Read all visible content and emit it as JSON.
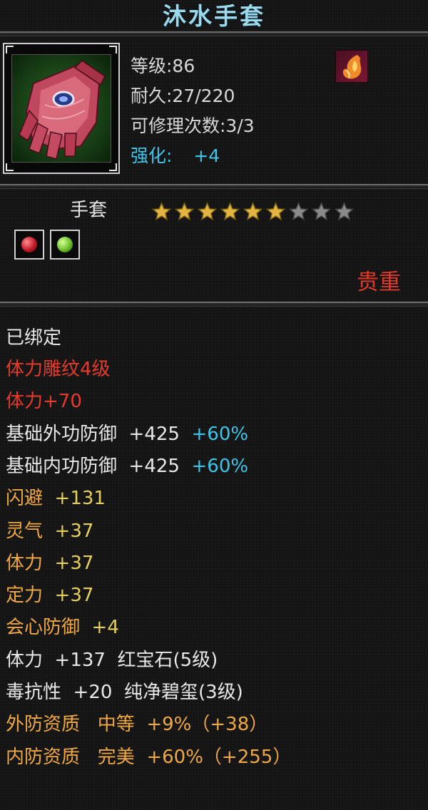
{
  "item": {
    "name": "沐水手套",
    "level": "等级:86",
    "durability": "耐久:27/220",
    "repair": "可修理次数:3/3",
    "enhance_label": "强化:",
    "enhance_value": "+4",
    "slot": "手套",
    "stars_total": 9,
    "stars_filled": 6,
    "rarity": "贵重",
    "bound": "已绑定"
  },
  "lines": [
    {
      "parts": [
        {
          "t": "体力雕纹4级",
          "c": "r"
        }
      ]
    },
    {
      "parts": [
        {
          "t": "体力+70",
          "c": "r"
        }
      ]
    },
    {
      "parts": [
        {
          "t": "基础外功防御",
          "c": "w"
        },
        {
          "t": "  +425  ",
          "c": "w"
        },
        {
          "t": "+60%",
          "c": "c"
        }
      ]
    },
    {
      "parts": [
        {
          "t": "基础内功防御",
          "c": "w"
        },
        {
          "t": "  +425  ",
          "c": "w"
        },
        {
          "t": "+60%",
          "c": "c"
        }
      ]
    },
    {
      "parts": [
        {
          "t": "闪避",
          "c": "o"
        },
        {
          "t": "  +131",
          "c": "y"
        }
      ]
    },
    {
      "parts": [
        {
          "t": "灵气",
          "c": "o"
        },
        {
          "t": "  +37",
          "c": "y"
        }
      ]
    },
    {
      "parts": [
        {
          "t": "体力",
          "c": "o"
        },
        {
          "t": "  +37",
          "c": "y"
        }
      ]
    },
    {
      "parts": [
        {
          "t": "定力",
          "c": "o"
        },
        {
          "t": "  +37",
          "c": "y"
        }
      ]
    },
    {
      "parts": [
        {
          "t": "会心防御",
          "c": "o"
        },
        {
          "t": "  +4",
          "c": "y"
        }
      ]
    },
    {
      "parts": [
        {
          "t": "体力",
          "c": "w"
        },
        {
          "t": "  +137  ",
          "c": "w"
        },
        {
          "t": "红宝石(5级)",
          "c": "w"
        }
      ]
    },
    {
      "parts": [
        {
          "t": "毒抗性",
          "c": "w"
        },
        {
          "t": "  +20  ",
          "c": "w"
        },
        {
          "t": "纯净碧玺(3级)",
          "c": "w"
        }
      ]
    },
    {
      "parts": [
        {
          "t": "外防资质",
          "c": "o"
        },
        {
          "t": "   中等  ",
          "c": "o"
        },
        {
          "t": "+9%",
          "c": "o"
        },
        {
          "t": "（+38）",
          "c": "o"
        }
      ]
    },
    {
      "parts": [
        {
          "t": "内防资质",
          "c": "o"
        },
        {
          "t": "   完美  ",
          "c": "o"
        },
        {
          "t": "+60%",
          "c": "o"
        },
        {
          "t": "（+255）",
          "c": "o"
        }
      ]
    }
  ],
  "colors": {
    "title": "#9ad9ee",
    "enhance": "#3ec6e8",
    "red": "#e53a2c",
    "orange": "#f0a843",
    "cyan": "#3fc3e6",
    "star_gold": "#e0b640",
    "star_gray": "#8a8a8a"
  },
  "icons": {
    "item": "gauntlet-icon",
    "badge": "flame-emblem-icon",
    "gem1": "red-gem-icon",
    "gem2": "green-gem-icon"
  }
}
